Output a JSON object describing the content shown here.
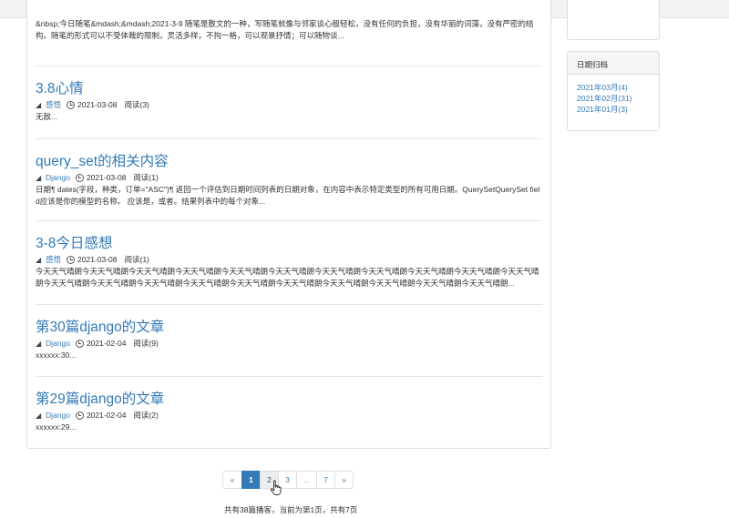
{
  "articles": [
    {
      "excerpt": "&nbsp;今日随笔&mdash;&mdash;2021-3-9 随笔是散文的一种，写随笔就像与邻家谈心般轻松，没有任何的负担，没有华丽的词藻，没有严密的结构。随笔的形式可以不受体裁的限制，灵活多样，不拘一格，可以观景抒情；可以随物谈..."
    },
    {
      "title": "3.8心情",
      "category": "感悟",
      "date": "2021-03-08",
      "reads": "阅读(3)",
      "excerpt": "无敌..."
    },
    {
      "title": "query_set的相关内容",
      "category": "Django",
      "date": "2021-03-08",
      "reads": "阅读(1)",
      "excerpt": "日期¶ dates(字段，种类，订单=\"ASC\")¶ 返回一个评估到日期时间列表的日期对象，在内容中表示特定类型的所有可用日期。QuerySetQuerySet field应该是你的模型的名称。 应该是，或者。结果列表中的每个对象..."
    },
    {
      "title": "3-8今日感想",
      "category": "感悟",
      "date": "2021-03-08",
      "reads": "阅读(1)",
      "excerpt": "今天天气晴朗今天天气晴朗今天天气晴朗今天天气晴朗今天天气晴朗今天天气晴朗今天天气晴朗今天天气晴朗今天天气晴朗今天天气晴朗今天天气晴朗今天天气晴朗今天天气晴朗今天天气晴朗今天天气晴朗今天天气晴朗今天天气晴朗今天天气晴朗今天天气晴朗今天天气晴朗今天天气晴朗..."
    },
    {
      "title": "第30篇django的文章",
      "category": "Django",
      "date": "2021-02-04",
      "reads": "阅读(9)",
      "excerpt": "xxxxxx:30..."
    },
    {
      "title": "第29篇django的文章",
      "category": "Django",
      "date": "2021-02-04",
      "reads": "阅读(2)",
      "excerpt": "xxxxxx:29..."
    }
  ],
  "sidebar": {
    "archive_title": "日期归档",
    "archive_items": [
      "2021年03月(4)",
      "2021年02月(31)",
      "2021年01月(3)"
    ]
  },
  "pagination": {
    "prev": "«",
    "pages": [
      "1",
      "2",
      "3",
      "...",
      "7"
    ],
    "next": "»",
    "active": "1",
    "hovered": "2"
  },
  "page_info": "共有38篇播客，当前为第1页，共有7页",
  "colors": {
    "link": "#337ab7",
    "active_page": "#337ab7"
  },
  "icons": {
    "category": "tag-icon",
    "date": "clock-icon",
    "cursor": "hand-pointer-icon"
  }
}
